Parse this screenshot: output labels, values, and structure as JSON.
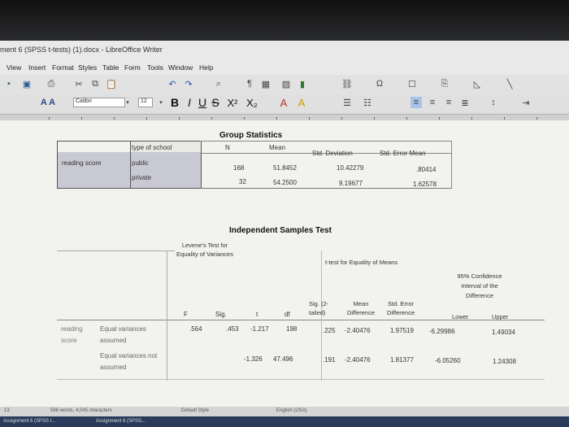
{
  "window": {
    "title": "ment 6 (SPSS t-tests) (1).docx - LibreOffice Writer"
  },
  "menu": [
    "View",
    "Insert",
    "Format",
    "Styles",
    "Table",
    "Form",
    "Tools",
    "Window",
    "Help"
  ],
  "format_bar": {
    "para_style": "A A",
    "font_name": "Calibri",
    "font_size": "12",
    "bold": "B",
    "italic": "I",
    "underline": "U",
    "strike": "S",
    "superscript": "X²",
    "subscript": "X₂"
  },
  "group_stats": {
    "title": "Group Statistics",
    "headers": [
      "type of school",
      "N",
      "Mean",
      "Std. Deviation",
      "Std. Error Mean"
    ],
    "row_label": "reading score",
    "rows": [
      {
        "group": "public",
        "n": "168",
        "mean": "51.8452",
        "sd": "10.42279",
        "se": ".80414"
      },
      {
        "group": "private",
        "n": "32",
        "mean": "54.2500",
        "sd": "9.19677",
        "se": "1.62578"
      }
    ]
  },
  "ind_test": {
    "title": "Independent Samples Test",
    "levene_header": "Levene's Test for Equality of Variances",
    "ttest_header": "t-test for Equality of Means",
    "ci_header": "95% Confidence Interval of the Difference",
    "col_f": "F",
    "col_sig": "Sig.",
    "col_t": "t",
    "col_df": "df",
    "col_sig2": "Sig. (2-tailed)",
    "col_mean_diff": "Mean Difference",
    "col_se_diff": "Std. Error Difference",
    "col_lower": "Lower",
    "col_upper": "Upper",
    "row_label": "reading score",
    "rows": [
      {
        "label": "Equal variances assumed",
        "f": ".564",
        "sig": ".453",
        "t": "-1.217",
        "df": "198",
        "sig2": ".225",
        "md": "-2.40476",
        "sed": "1.97519",
        "lower": "-6.29986",
        "upper": "1.49034"
      },
      {
        "label": "Equal variances not assumed",
        "f": "",
        "sig": "",
        "t": "-1.326",
        "df": "47.496",
        "sig2": ".191",
        "md": "-2.40476",
        "sed": "1.81377",
        "lower": "-6.05260",
        "upper": "1.24308"
      }
    ]
  },
  "status": {
    "page": "13",
    "words": "586 words, 4,045 characters",
    "style": "Default Style",
    "language": "English (USA)"
  },
  "taskbar": [
    "Assignment 6 (SPSS t...",
    "Assignment 6 (SPSS..."
  ]
}
